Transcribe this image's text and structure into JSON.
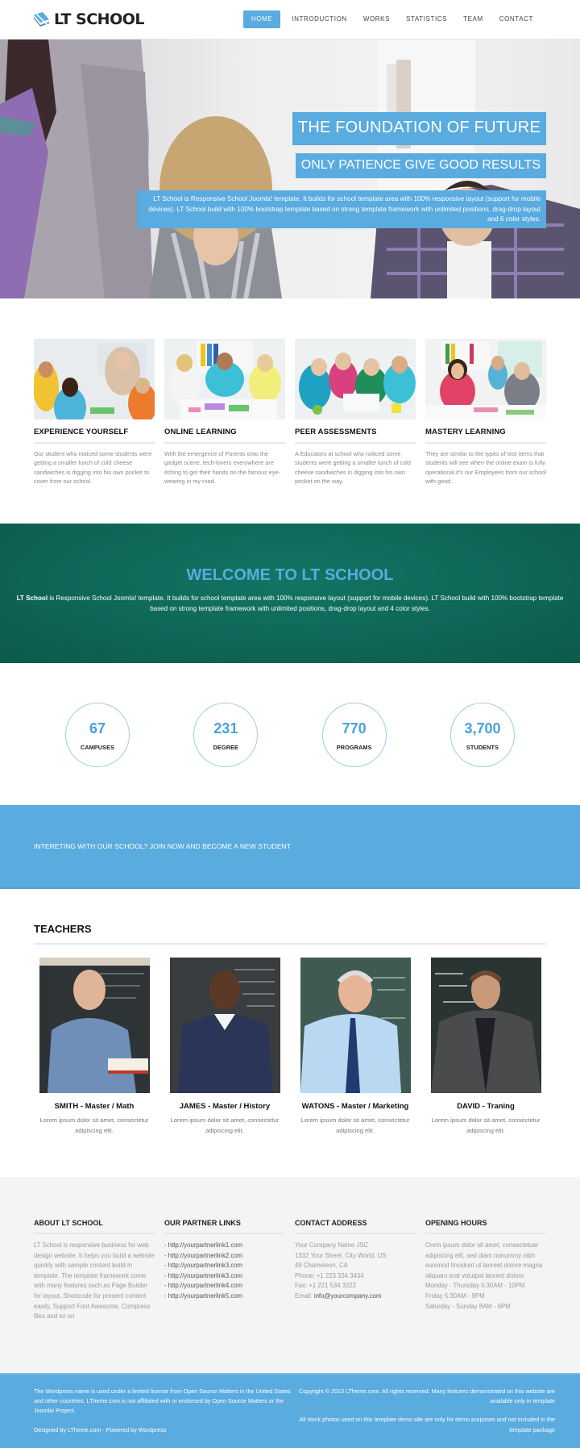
{
  "header": {
    "logo_text": "LT SCHOOL",
    "nav": [
      {
        "label": "HOME",
        "active": true
      },
      {
        "label": "INTRODUCTION",
        "active": false
      },
      {
        "label": "WORKS",
        "active": false
      },
      {
        "label": "STATISTICS",
        "active": false
      },
      {
        "label": "TEAM",
        "active": false
      },
      {
        "label": "CONTACT",
        "active": false
      }
    ]
  },
  "hero": {
    "title": "THE FOUNDATION OF FUTURE",
    "subtitle": "ONLY PATIENCE GIVE GOOD RESULTS",
    "description": "LT School is Responsive School Joomla! template. It builds for school template area with 100% responsive layout (support for mobile devices). LT School build with 100% bootstrap template based on strong template framework with unlimited positions, drag-drop layout and 6 color styles."
  },
  "features": [
    {
      "title": "EXPERIENCE YOURSELF",
      "text": "Our student who noticed some students were getting a smaller lunch of cold cheese sandwiches is digging into his own pocket to cover from our school."
    },
    {
      "title": "ONLINE LEARNING",
      "text": "With the emergence of Parents onto the gadget scene, tech-lovers everywhere are itching to get their hands on the famous eye-wearing in my road."
    },
    {
      "title": "PEER ASSESSMENTS",
      "text": "A Educators at school who noticed some students were getting a smaller lunch of cold cheese sandwiches is digging into his own pocket on the way."
    },
    {
      "title": "MASTERY LEARNING",
      "text": "They are similar to the types of test items that students will see when the online exam is fully operational.it's our Employees from our school with good."
    }
  ],
  "welcome": {
    "title": "WELCOME TO LT SCHOOL",
    "text_bold": "LT School",
    "text_line1": " is Responsive School Joomla! template. It builds for school template area with 100% responsive layout (support for mobile devices). LT School build with 100% bootstrap template",
    "text_line2": "based on strong template framework with unlimited positions, drag-drop layout and 4 color styles."
  },
  "stats": [
    {
      "value": "67",
      "label": "CAMPUSES"
    },
    {
      "value": "231",
      "label": "DEGREE"
    },
    {
      "value": "770",
      "label": "PROGRAMS"
    },
    {
      "value": "3,700",
      "label": "STUDENTS"
    }
  ],
  "cta": {
    "text": "INTERETING WITH OUR SCHOOL? JOIN NOW AND BECOME A NEW STUDENT"
  },
  "teachers": {
    "title": "TEACHERS",
    "items": [
      {
        "name": "SMITH - Master / Math",
        "desc": "Lorem ipsum dolor sit amet, consectetur adipiscing elit."
      },
      {
        "name": "JAMES - Master / History",
        "desc": "Lorem ipsum dolor sit amet, consectetur adipiscing elit."
      },
      {
        "name": "WATONS - Master / Marketing",
        "desc": "Lorem ipsum dolor sit amet, consectetur adipiscing elit."
      },
      {
        "name": "DAVID - Traning",
        "desc": "Lorem ipsum dolor sit amet, consectetur adipiscing elit."
      }
    ]
  },
  "footer": {
    "about": {
      "title": "ABOUT LT SCHOOL",
      "text": "LT School is responsive business for web design website. It helps you build a website quickly with sample content build-in template. The template framework come with many features such as Page Builder for layout, Shortcode for present content easily, Support Font Awesome, Compress files and so on"
    },
    "partners": {
      "title": "OUR PARTNER LINKS",
      "links": [
        "- http://yourpartnerlink1.com",
        "- http://yourpartnerlink2.com",
        "- http://yourpartnerlink3.com",
        "- http://yourpartnerlink3.com",
        "- http://yourpartnerlink4.com",
        "- http://yourpartnerlink5.com"
      ]
    },
    "contact": {
      "title": "CONTACT ADDRESS",
      "company": "Your Company Name JSC",
      "street": "1332 Your Street, City World, US",
      "city": "49 Chameleon, CA",
      "phone": "Phone: +1 223 334 3434",
      "fax": "Fax: +1 221 534 3222",
      "email_label": "Email: ",
      "email": "info@yourcompany.com"
    },
    "hours": {
      "title": "OPENING HOURS",
      "text": "Orem ipsum dolor sit amet, consectetuer adipiscing elit, sed diam nonummy nibh euismod tincidunt ut laoreet dolore magna aliquam erat volutpat laoreet dolore",
      "lines": [
        "Monday - Thursday 5:30AM - 10PM",
        "Friday 5:30AM - 9PM",
        "Saturday - Sunday 8AM - 6PM"
      ]
    },
    "bottom": {
      "license": "The Wordpress name is used under a limited license from Open Source Matters in the United States and other countries. LTheme.com is not affiliated with or endorsed by Open Source Matters or the Joomla! Project.",
      "designed": "Designed by LTheme.com - Powered by Wordpress",
      "copyright": "Copyright © 2013 LTheme.com. All rights reserved. Many features demonstrated on this website are available only in template",
      "photos": "All stock photos used on this template demo site are only for demo purposes and not included in the template package"
    }
  },
  "colors": {
    "accent": "#5aabdf",
    "welcome_bg": "#0e6556",
    "footer_bg": "#f4f4f4"
  }
}
